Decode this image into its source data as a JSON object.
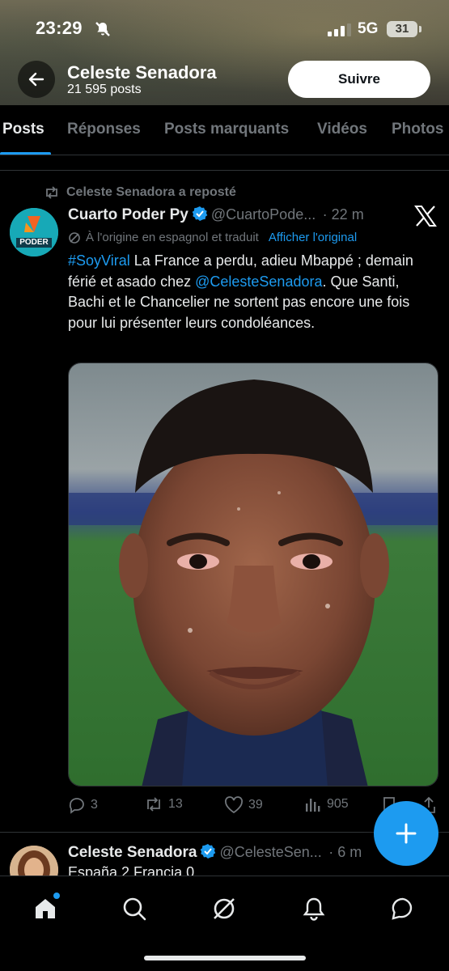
{
  "status_bar": {
    "time": "23:29",
    "network": "5G",
    "battery": "31"
  },
  "header": {
    "name": "Celeste Senadora",
    "posts_count": "21 595 posts",
    "follow_label": "Suivre"
  },
  "tabs": [
    {
      "label": "Posts",
      "active": true
    },
    {
      "label": "Réponses",
      "active": false
    },
    {
      "label": "Posts marquants",
      "active": false
    },
    {
      "label": "Vidéos",
      "active": false
    },
    {
      "label": "Photos",
      "active": false
    }
  ],
  "post1": {
    "repost_label": "Celeste Senadora a reposté",
    "avatar_text": "PODER",
    "author": "Cuarto Poder Py",
    "handle": "@CuartoPode...",
    "time": "· 22 m",
    "translation_note": "À l'origine en espagnol et traduit",
    "translation_link": "Afficher l'original",
    "text_hashtag": "#SoyViral",
    "text_part1": " La France a perdu, adieu Mbappé ; demain férié et asado chez ",
    "text_mention": "@CelesteSenadora",
    "text_part2": ". Que Santi, Bachi et le Chancelier ne sortent pas encore une fois pour lui présenter leurs condoléances.",
    "replies": "3",
    "reposts": "13",
    "likes": "39",
    "views": "905"
  },
  "post2": {
    "author": "Celeste Senadora",
    "handle": "@CelesteSen...",
    "time": "· 6 m",
    "text": "España 2 Francia 0"
  },
  "colors": {
    "accent": "#1d9bf0",
    "muted": "#71767b",
    "text": "#e7e9ea",
    "background": "#000000"
  }
}
